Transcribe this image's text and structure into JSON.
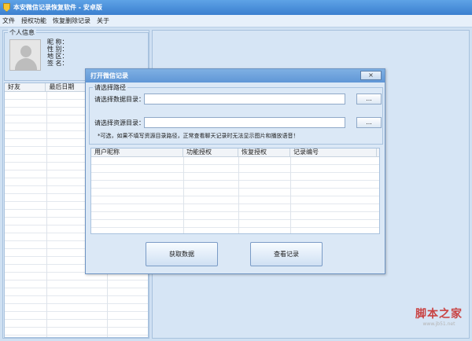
{
  "window": {
    "title": "本安微信记录恢复软件 - 安卓版"
  },
  "menu": [
    "文件",
    "授权功能",
    "恢复删除记录",
    "关于"
  ],
  "profile": {
    "group_label": "个人信息",
    "fields": [
      "昵 称：",
      "性 别：",
      "地 区：",
      "签 名："
    ]
  },
  "friend_list": {
    "columns": [
      "好友",
      "最后日期",
      ""
    ]
  },
  "dialog": {
    "title": "打开微信记录",
    "close_label": "×",
    "path_group_label": "请选择路径",
    "data_dir_label": "请选择数据目录：",
    "data_dir_value": "",
    "resource_dir_label": "请选择资源目录：",
    "resource_dir_value": "",
    "browse_label": "...",
    "hint": "*可选，如果不填写资源目录路径，正常查看聊天记录时无法显示图片和播放语音！",
    "table_columns": [
      "用户昵称",
      "功能授权",
      "恢复授权",
      "记录编号"
    ],
    "fetch_button": "获取数据",
    "view_button": "查看记录"
  },
  "watermark": {
    "text": "脚本之家",
    "url": "www.jb51.net"
  },
  "colors": {
    "titlebar": "#3b7fcf",
    "panel": "#d6e5f5",
    "watermark": "#c94444"
  }
}
